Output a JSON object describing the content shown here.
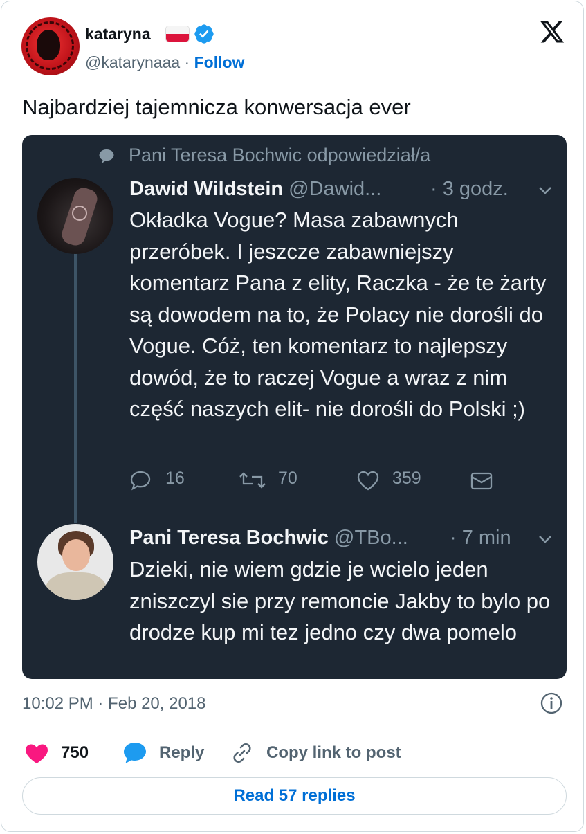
{
  "post": {
    "author_name": "kataryna",
    "author_handle": "@katarynaaa",
    "separator": "·",
    "follow_label": "Follow",
    "text": "Najbardziej tajemnicza konwersacja ever",
    "timestamp": "10:02 PM · Feb 20, 2018",
    "likes": "750",
    "reply_label": "Reply",
    "copy_link_label": "Copy link to post",
    "read_replies_label": "Read 57 replies"
  },
  "embedded": {
    "context": "Pani Teresa Bochwic odpowiedział/a",
    "tweets": [
      {
        "name": "Dawid Wildstein",
        "handle": "@Dawid...",
        "time": "· 3 godz.",
        "text": "Okładka Vogue? Masa zabawnych przeróbek. I jeszcze zabawniejszy komentarz Pana z elity, Raczka - że te żarty są dowodem na to, że Polacy nie dorośli do Vogue. Cóż, ten komentarz to najlepszy dowód, że to raczej Vogue a wraz z nim część naszych elit- nie dorośli do Polski ;)",
        "replies": "16",
        "retweets": "70",
        "likes": "359"
      },
      {
        "name": "Pani Teresa Bochwic",
        "handle": "@TBo...",
        "time": "· 7 min",
        "text": "Dzieki, nie wiem gdzie je wcielo jeden zniszczyl sie przy remoncie Jakby to bylo po drodze kup mi tez jedno czy dwa pomelo"
      }
    ]
  },
  "colors": {
    "accent": "#006fd6",
    "verified": "#1d9bf0",
    "like": "#f91880",
    "embed_bg": "#1d2733"
  },
  "icons": [
    "verified-badge-icon",
    "x-logo-icon",
    "reply-context-icon",
    "chevron-down-icon",
    "comment-icon",
    "retweet-icon",
    "heart-outline-icon",
    "mail-icon",
    "info-icon",
    "heart-icon",
    "reply-bubble-icon",
    "link-icon"
  ]
}
